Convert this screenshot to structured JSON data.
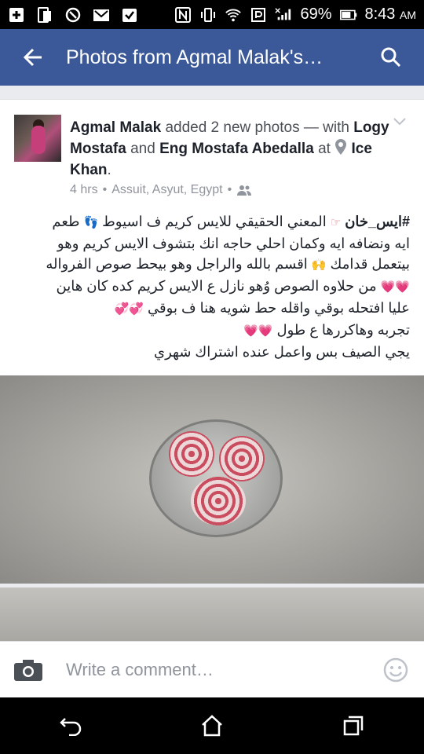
{
  "status": {
    "battery": "69%",
    "time": "8:43",
    "ampm": "AM"
  },
  "appbar": {
    "title": "Photos from Agmal Malak's…"
  },
  "post": {
    "author": "Agmal Malak",
    "action": "added 2 new photos —",
    "with_word": "with",
    "tag1": "Logy Mostafa",
    "and_word": "and",
    "tag2": "Eng Mostafa Abedalla",
    "at_word": "at",
    "place": "Ice Khan",
    "time": "4 hrs",
    "location": "Assuit, Asyut, Egypt",
    "hashtag": "#ايس_خان",
    "line1": "المعني الحقيقي للايس كريم ف اسيوط",
    "line1b": "طعم",
    "line2": "ايه ونضافه ايه وكمان احلي حاجه انك بتشوف الايس كريم وهو",
    "line3a": "بيتعمل قدامك",
    "line3b": "اقسم بالله والراجل وهو بيحط صوص الفرواله",
    "line4": "من حلاوه الصوص وُهو نازل ع الايس كريم كده  كان هاين",
    "line5": "عليا افتحله بوقي واقله حط شويه هنا ف بوقي",
    "line6": "تجربه وهاكررها ع طول",
    "line7": "يجي الصيف بس واعمل عنده اشتراك شهري"
  },
  "comment": {
    "placeholder": "Write a comment…"
  },
  "colors": {
    "brand": "#3b5998",
    "muted": "#90949c"
  }
}
